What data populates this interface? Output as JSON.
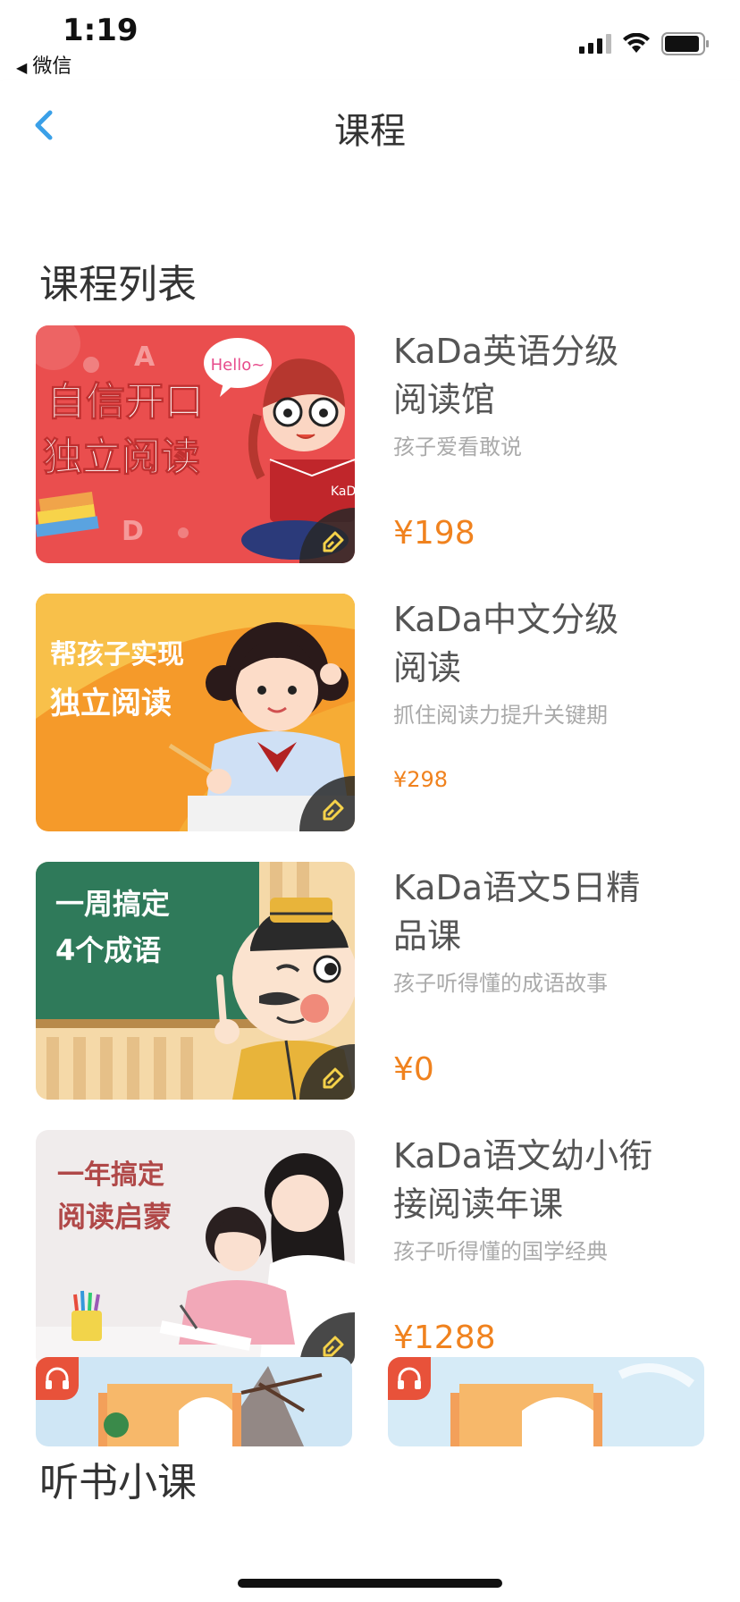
{
  "status": {
    "time": "1:19",
    "back_app": "微信"
  },
  "nav": {
    "title": "课程"
  },
  "sections": {
    "courses_title": "课程列表",
    "audio_title": "听书小课"
  },
  "courses": [
    {
      "title_line1": "KaDa英语分级",
      "title_line2": "阅读馆",
      "subtitle": "孩子爱看敢说",
      "price": "¥198",
      "thumb_line1": "自信开口",
      "thumb_line2": "独立阅读",
      "thumb_bubble": "Hello~"
    },
    {
      "title_line1": "KaDa中文分级",
      "title_line2": "阅读",
      "subtitle": "抓住阅读力提升关键期",
      "price": "¥298",
      "thumb_line1": "帮孩子实现",
      "thumb_line2": "独立阅读"
    },
    {
      "title_line1": "KaDa语文5日精",
      "title_line2": "品课",
      "subtitle": "孩子听得懂的成语故事",
      "price": "¥0",
      "thumb_line1": "一周搞定",
      "thumb_line2": "4个成语"
    },
    {
      "title_line1": "KaDa语文幼小衔",
      "title_line2": "接阅读年课",
      "subtitle": "孩子听得懂的国学经典",
      "price": "¥1288",
      "thumb_line1": "一年搞定",
      "thumb_line2": "阅读启蒙"
    }
  ],
  "colors": {
    "accent_blue": "#3aa0e8",
    "price_orange": "#f0821e",
    "thumb1_bg": "#ea4e4e",
    "thumb2_bg": "#f59a2a",
    "thumb3_bg": "#2f7a5a",
    "thumb4_bg": "#f0ecec"
  }
}
